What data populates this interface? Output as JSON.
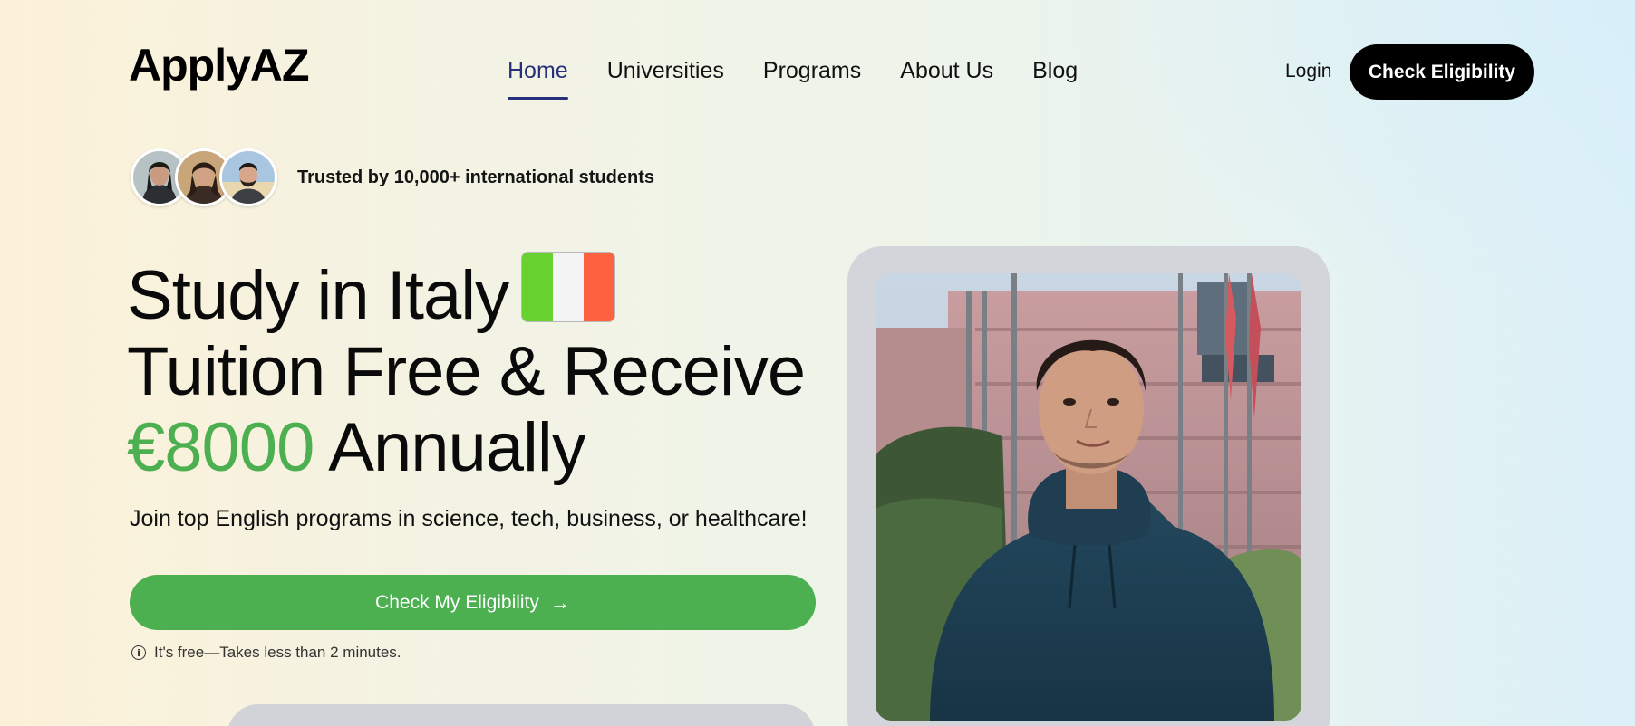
{
  "brand": {
    "logo": "ApplyAZ"
  },
  "nav": {
    "items": [
      {
        "label": "Home",
        "active": true
      },
      {
        "label": "Universities",
        "active": false
      },
      {
        "label": "Programs",
        "active": false
      },
      {
        "label": "About Us",
        "active": false
      },
      {
        "label": "Blog",
        "active": false
      }
    ],
    "login": "Login",
    "cta": "Check Eligibility"
  },
  "trust": {
    "text": "Trusted by 10,000+ international students"
  },
  "hero": {
    "line1": "Study in Italy",
    "line2": "Tuition Free & Receive",
    "price": "€8000",
    "line3_rest": " Annually",
    "subtitle": "Join top English programs in science, tech, business, or healthcare!",
    "cta": "Check My Eligibility",
    "note": "It's free—Takes less than 2 minutes."
  },
  "colors": {
    "accent_green": "#4caf50",
    "nav_active": "#27307a",
    "black": "#000000",
    "flag_green": "#67d22f",
    "flag_white": "#f4f4f4",
    "flag_red": "#ff6241"
  }
}
